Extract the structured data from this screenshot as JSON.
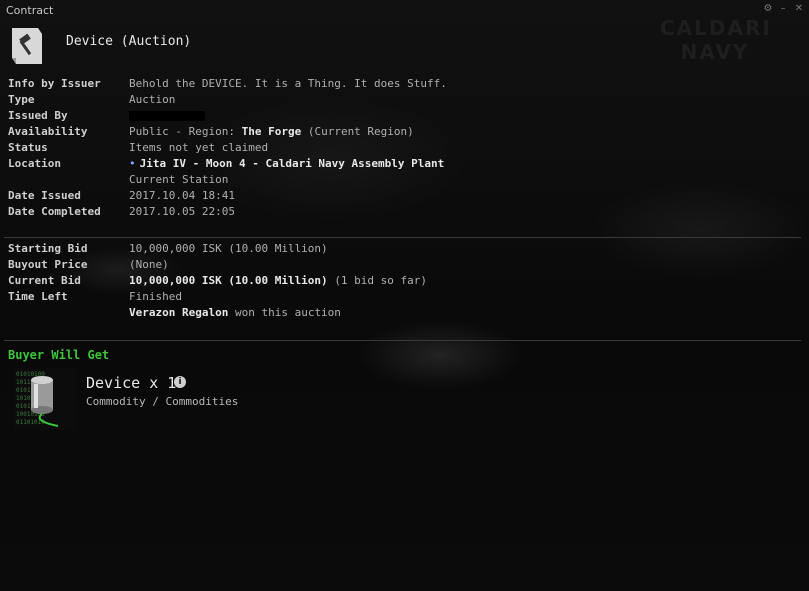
{
  "window": {
    "title": "Contract"
  },
  "header": {
    "title": "Device (Auction)"
  },
  "details": {
    "info_label": "Info by Issuer",
    "info_value": "Behold the DEVICE. It is a Thing. It does Stuff.",
    "type_label": "Type",
    "type_value": "Auction",
    "issued_by_label": "Issued By",
    "availability_label": "Availability",
    "availability_prefix": "Public - Region:",
    "availability_region": "The Forge",
    "availability_suffix": "(Current Region)",
    "status_label": "Status",
    "status_value": "Items not yet claimed",
    "location_label": "Location",
    "location_value": "Jita IV - Moon 4 - Caldari Navy Assembly Plant",
    "location_sub": "Current Station",
    "date_issued_label": "Date Issued",
    "date_issued_value": "2017.10.04 18:41",
    "date_completed_label": "Date Completed",
    "date_completed_value": "2017.10.05 22:05"
  },
  "bidding": {
    "starting_bid_label": "Starting Bid",
    "starting_bid_value": "10,000,000 ISK (10.00 Million)",
    "buyout_label": "Buyout Price",
    "buyout_value": "(None)",
    "current_bid_label": "Current Bid",
    "current_bid_value": "10,000,000 ISK (10.00 Million)",
    "current_bid_note": "(1 bid so far)",
    "time_left_label": "Time Left",
    "time_left_value": "Finished",
    "winner_name": "Verazon Regalon",
    "winner_text": "won this auction"
  },
  "buyer": {
    "section_title": "Buyer Will Get",
    "item_name": "Device x 1",
    "item_category": "Commodity / Commodities"
  },
  "background": {
    "corp_mark": "CALDARI NAVY"
  },
  "colors": {
    "accent_green": "#3cc63c",
    "background": "#0a0a0a",
    "label": "#cfcfcf",
    "value": "#b0b0b0"
  }
}
